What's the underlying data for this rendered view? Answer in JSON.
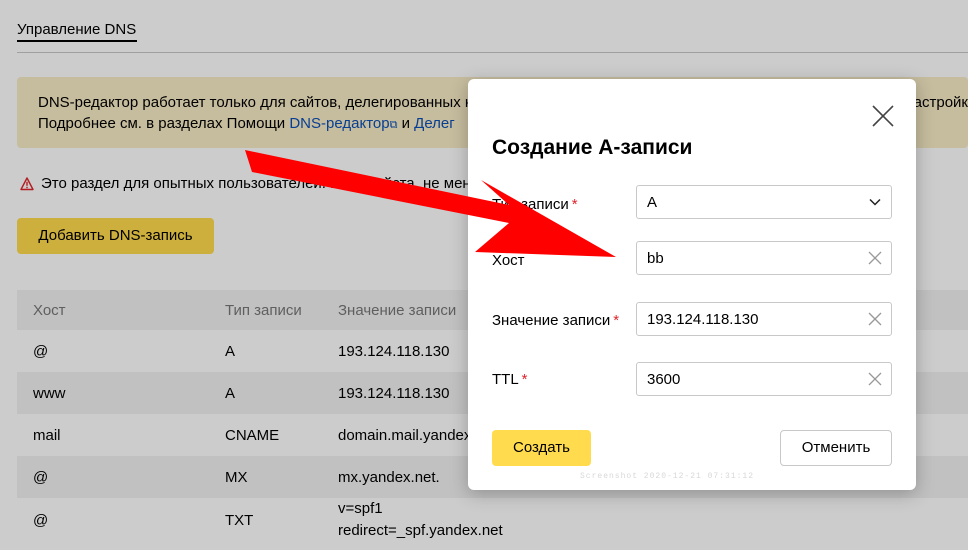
{
  "header": {
    "title": "Управление DNS"
  },
  "info": {
    "line1": "DNS-редактор работает только для сайтов, делегированных н",
    "line1_right": "астройк",
    "line2_prefix": "Подробнее см. в разделах Помощи ",
    "link1": "DNS-редактор",
    "link_sep": " и ",
    "link2": "Делег"
  },
  "warning": {
    "text": "Это раздел для опытных пользователей. Пожалуйста, не мен"
  },
  "add_button": {
    "label": "Добавить DNS-запись"
  },
  "table": {
    "headers": [
      "Хост",
      "Тип записи",
      "Значение записи"
    ],
    "rows": [
      [
        "@",
        "A",
        "193.124.118.130"
      ],
      [
        "www",
        "A",
        "193.124.118.130"
      ],
      [
        "mail",
        "CNAME",
        "domain.mail.yandex."
      ],
      [
        "@",
        "MX",
        "mx.yandex.net."
      ],
      [
        "@",
        "TXT",
        "v=spf1",
        "redirect=_spf.yandex.net"
      ]
    ]
  },
  "modal": {
    "title": "Создание А-записи",
    "fields": [
      {
        "label": "Тип записи",
        "required": "*",
        "value": "A"
      },
      {
        "label": "Хост",
        "required": "",
        "value": "bb"
      },
      {
        "label": "Значение записи",
        "required": "*",
        "value": "193.124.118.130"
      },
      {
        "label": "TTL",
        "required": "*",
        "value": "3600"
      }
    ],
    "create_label": "Создать",
    "cancel_label": "Отменить"
  },
  "watermark": "Screenshot 2020-12-21 07:31:12",
  "colors": {
    "accent": "#ffdb4d",
    "arrow": "#ff0000",
    "link": "#0a4fb8",
    "info_bg": "#f8ecc6",
    "required": "#e0242b"
  },
  "icons": {
    "close": "close-icon",
    "clear": "clear-icon",
    "dropdown": "chevron-down-icon",
    "warning": "warning-icon",
    "external": "external-link-icon"
  }
}
